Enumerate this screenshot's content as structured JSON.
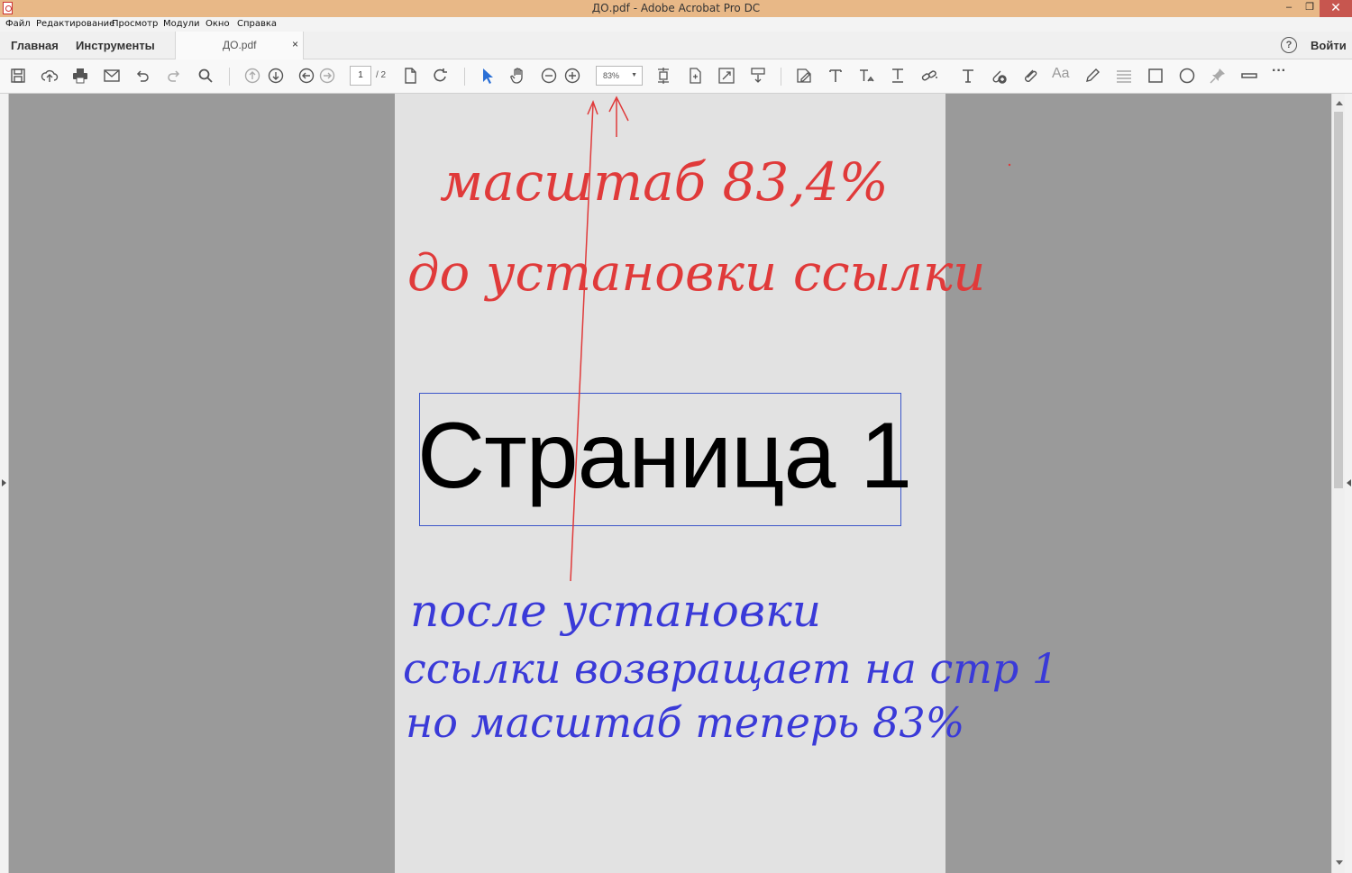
{
  "window": {
    "title": "ДО.pdf - Adobe Acrobat Pro DC",
    "min": "–",
    "max": "❐",
    "close": "✕"
  },
  "menu": [
    "Файл",
    "Редактирование",
    "Просмотр",
    "Модули",
    "Окно",
    "Справка"
  ],
  "tabs": {
    "home": "Главная",
    "tools": "Инструменты",
    "document": "ДО.pdf",
    "close": "×",
    "help": "?",
    "login": "Войти"
  },
  "toolbar": {
    "page_current": "1",
    "page_total": "/ 2",
    "zoom": "83%",
    "aa_label": "Aa",
    "more": "···"
  },
  "document": {
    "page_title": "Страница 1"
  },
  "annotations": {
    "red_line1": "масштаб 83,4%",
    "red_line2": "до установки ссылки",
    "blue_line1": "после установки",
    "blue_line2": "ссылки возвращает на стр 1",
    "blue_line3": "но масштаб теперь 83%"
  },
  "colors": {
    "titlebar": "#e8b887",
    "red_ink": "#e03a3a",
    "blue_ink": "#3a3ad8",
    "selection_box": "#3b55c9"
  }
}
